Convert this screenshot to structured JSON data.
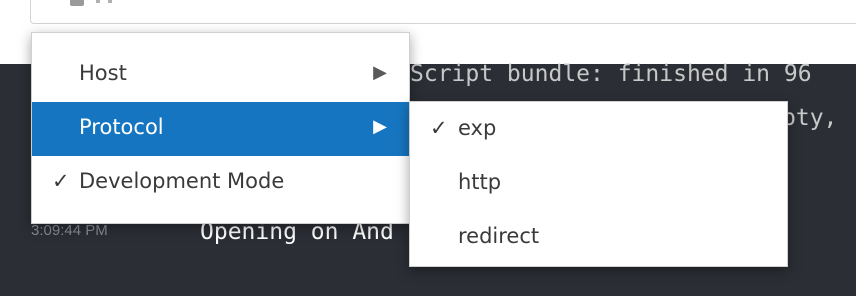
{
  "log": {
    "line1": "Script bundle: finished in 96",
    "line2_tail": "pty,",
    "line3_text": "Opening on And",
    "line3_time": "3:09:44 PM"
  },
  "menu": {
    "items": [
      {
        "label": "Host",
        "check": "",
        "arrow": "▶"
      },
      {
        "label": "Protocol",
        "check": "",
        "arrow": "▶"
      },
      {
        "label": "Development Mode",
        "check": "✓",
        "arrow": ""
      }
    ]
  },
  "submenu": {
    "items": [
      {
        "label": "exp",
        "check": "✓"
      },
      {
        "label": "http",
        "check": ""
      },
      {
        "label": "redirect",
        "check": ""
      }
    ]
  },
  "colors": {
    "log_background": "#2b2e35",
    "selection": "#1675c0"
  },
  "icons": {
    "toolbar_left": "device-icon",
    "submenu_arrow": "triangle-right-icon",
    "checkmark": "checkmark-icon"
  }
}
